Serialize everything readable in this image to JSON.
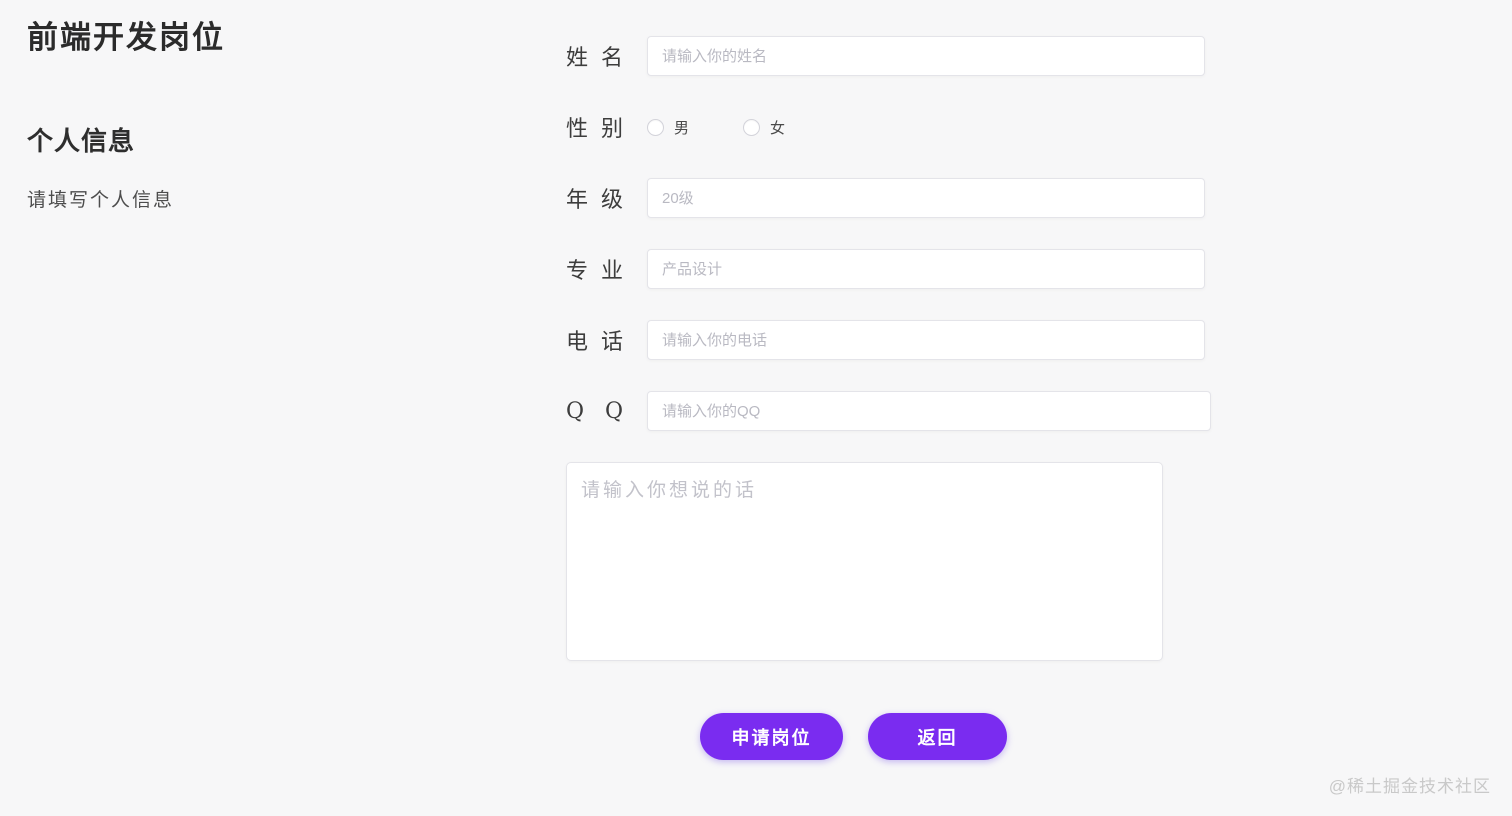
{
  "header": {
    "title": "前端开发岗位",
    "section_title": "个人信息",
    "section_desc": "请填写个人信息"
  },
  "form": {
    "name": {
      "label": "姓 名",
      "placeholder": "请输入你的姓名"
    },
    "gender": {
      "label": "性 别",
      "male_label": "男",
      "female_label": "女"
    },
    "grade": {
      "label": "年 级",
      "placeholder": "20级"
    },
    "major": {
      "label": "专 业",
      "placeholder": "产品设计"
    },
    "phone": {
      "label": "电 话",
      "placeholder": "请输入你的电话"
    },
    "qq": {
      "label": "Q Q",
      "placeholder": "请输入你的QQ"
    },
    "message": {
      "placeholder": "请输入你想说的话"
    }
  },
  "buttons": {
    "apply": "申请岗位",
    "back": "返回"
  },
  "colors": {
    "accent": "#7a2cf0",
    "page_background": "#f7f7f8"
  },
  "watermark": "@稀土掘金技术社区"
}
